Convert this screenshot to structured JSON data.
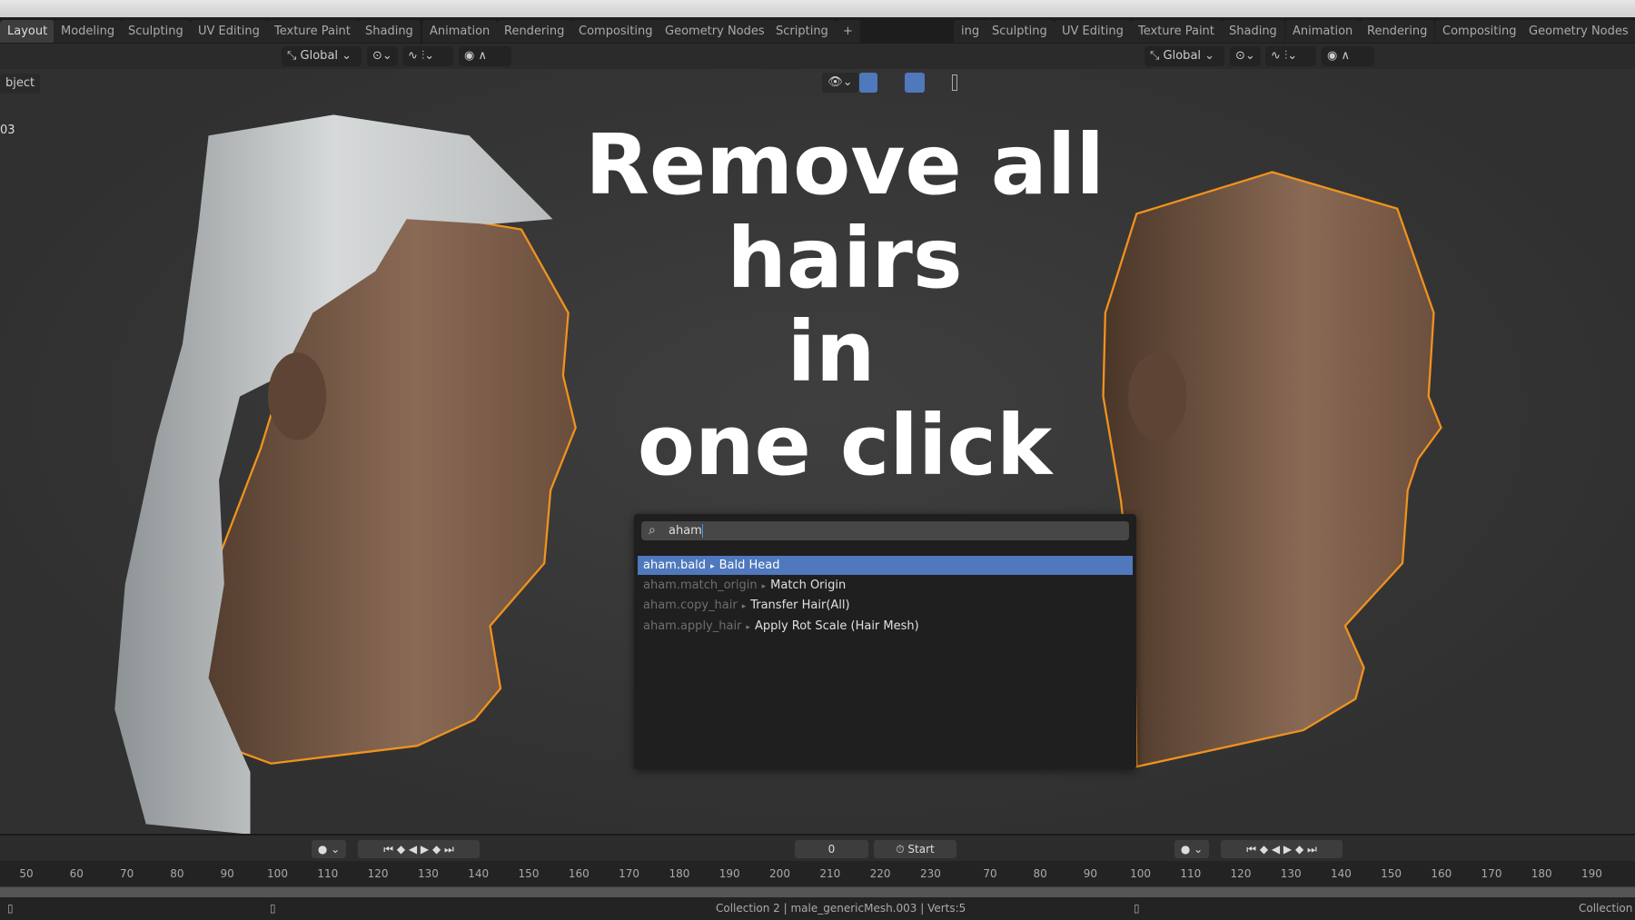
{
  "tabs_left": [
    "Layout",
    "Modeling",
    "Sculpting",
    "UV Editing",
    "Texture Paint",
    "Shading",
    "Animation",
    "Rendering",
    "Compositing",
    "Geometry Nodes",
    "Scripting",
    "+"
  ],
  "tabs_right": [
    "ing",
    "Sculpting",
    "UV Editing",
    "Texture Paint",
    "Shading",
    "Animation",
    "Rendering",
    "Compositing",
    "Geometry Nodes"
  ],
  "header": {
    "orientation": "Global",
    "orientation_right": "Global"
  },
  "viewport": {
    "mode_label": "bject",
    "object_suffix": "03"
  },
  "overlay_text": [
    "Remove all",
    "hairs",
    "in",
    "one click"
  ],
  "search": {
    "value": "aham",
    "results": [
      {
        "id": "aham.bald",
        "label": "Bald Head",
        "selected": true
      },
      {
        "id": "aham.match_origin",
        "label": "Match Origin"
      },
      {
        "id": "aham.copy_hair",
        "label": "Transfer Hair(All)"
      },
      {
        "id": "aham.apply_hair",
        "label": "Apply Rot Scale (Hair Mesh)"
      }
    ]
  },
  "timeline": {
    "current_frame": "0",
    "start_label": "Start",
    "ruler_left": [
      "50",
      "60",
      "70",
      "80",
      "90",
      "100",
      "110",
      "120",
      "130",
      "140",
      "150",
      "160",
      "170",
      "180",
      "190",
      "200",
      "210",
      "220",
      "230"
    ],
    "ruler_right": [
      "70",
      "80",
      "90",
      "100",
      "110",
      "120",
      "130",
      "140",
      "150",
      "160",
      "170",
      "180",
      "190"
    ]
  },
  "status": {
    "center": "Collection 2 | male_genericMesh.003 | Verts:5",
    "right": "Collection"
  },
  "colors": {
    "selection_outline": "#f0921e",
    "highlight": "#4f78bd"
  }
}
